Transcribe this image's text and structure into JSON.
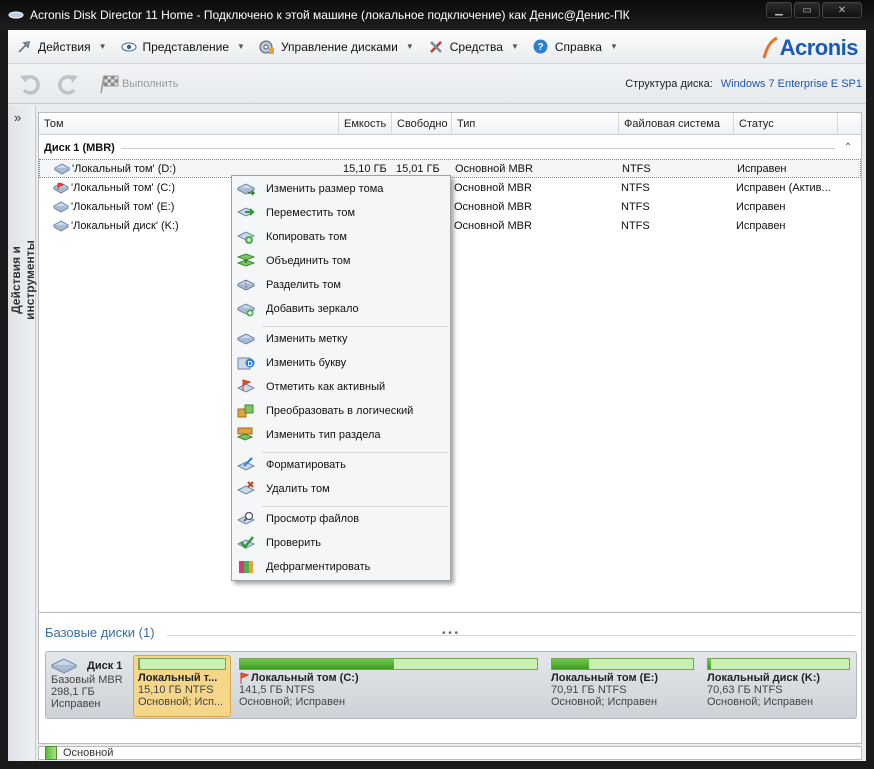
{
  "window": {
    "title": "Acronis Disk Director 11 Home - Подключено к этой машине (локальное подключение) как Денис@Денис-ПК",
    "buttons": [
      "▁",
      "▭",
      "✕"
    ]
  },
  "menubar": {
    "items": [
      {
        "label": "Действия",
        "icon": "actions-icon"
      },
      {
        "label": "Представление",
        "icon": "eye-icon"
      },
      {
        "label": "Управление дисками",
        "icon": "disk-manage-icon"
      },
      {
        "label": "Средства",
        "icon": "tools-icon"
      },
      {
        "label": "Справка",
        "icon": "help-icon"
      }
    ],
    "logo": "Acronis"
  },
  "toolbar": {
    "run_label": "Выполнить",
    "disk_structure_label": "Структура диска:",
    "disk_structure_value": "Windows 7 Enterprise E SP1"
  },
  "sidebar": {
    "label": "Действия и инструменты",
    "chevron": "»"
  },
  "table": {
    "columns": [
      "Том",
      "Емкость",
      "Свободно",
      "Тип",
      "Файловая система",
      "Статус"
    ],
    "group": "Диск 1 (MBR)",
    "rows": [
      {
        "name": "'Локальный том' (D:)",
        "capacity": "15,10 ГБ",
        "free": "15,01 ГБ",
        "type": "Основной MBR",
        "fs": "NTFS",
        "status": "Исправен",
        "selected": true
      },
      {
        "name": "'Локальный том' (C:)",
        "capacity": "",
        "free": "",
        "type": "Основной MBR",
        "fs": "NTFS",
        "status": "Исправен (Актив...",
        "selected": false
      },
      {
        "name": "'Локальный том' (E:)",
        "capacity": "",
        "free": "",
        "type": "Основной MBR",
        "fs": "NTFS",
        "status": "Исправен",
        "selected": false
      },
      {
        "name": "'Локальный диск' (K:)",
        "capacity": "",
        "free": "",
        "type": "Основной MBR",
        "fs": "NTFS",
        "status": "Исправен",
        "selected": false
      }
    ]
  },
  "context_menu": {
    "items": [
      {
        "label": "Изменить размер тома",
        "icon": "resize-volume-icon"
      },
      {
        "label": "Переместить том",
        "icon": "move-volume-icon"
      },
      {
        "label": "Копировать том",
        "icon": "copy-volume-icon"
      },
      {
        "label": "Объединить том",
        "icon": "merge-volume-icon"
      },
      {
        "label": "Разделить том",
        "icon": "split-volume-icon"
      },
      {
        "label": "Добавить зеркало",
        "icon": "add-mirror-icon"
      },
      {
        "label": "Изменить метку",
        "icon": "change-label-icon"
      },
      {
        "label": "Изменить букву",
        "icon": "change-letter-icon"
      },
      {
        "label": "Отметить как активный",
        "icon": "mark-active-icon"
      },
      {
        "label": "Преобразовать в логический",
        "icon": "convert-logical-icon"
      },
      {
        "label": "Изменить тип раздела",
        "icon": "partition-type-icon"
      },
      {
        "label": "Форматировать",
        "icon": "format-icon"
      },
      {
        "label": "Удалить том",
        "icon": "delete-volume-icon"
      },
      {
        "label": "Просмотр файлов",
        "icon": "browse-files-icon"
      },
      {
        "label": "Проверить",
        "icon": "check-icon"
      },
      {
        "label": "Дефрагментировать",
        "icon": "defrag-icon"
      }
    ]
  },
  "basic_disks": {
    "title": "Базовые диски (1)",
    "disk": {
      "name": "Диск 1",
      "type": "Базовый MBR",
      "size": "298,1 ГБ",
      "status": "Исправен"
    },
    "volumes": [
      {
        "name": "Локальный т...",
        "size": "15,10 ГБ NTFS",
        "status": "Основной; Исп...",
        "used_fraction": 0.01,
        "selected": true
      },
      {
        "name": "Локальный том (C:)",
        "size": "141,5 ГБ NTFS",
        "status": "Основной; Исправен",
        "used_fraction": 0.52,
        "selected": false
      },
      {
        "name": "Локальный том (E:)",
        "size": "70,91 ГБ NTFS",
        "status": "Основной; Исправен",
        "used_fraction": 0.26,
        "selected": false
      },
      {
        "name": "Локальный диск (K:)",
        "size": "70,63 ГБ NTFS",
        "status": "Основной; Исправен",
        "used_fraction": 0.02,
        "selected": false
      }
    ]
  },
  "legend": {
    "label": "Основной"
  },
  "colors": {
    "accent": "#1c56b5",
    "title_blue": "#3a6ea5",
    "selection": "#f6d78a",
    "bar_green": "#4fb42e"
  }
}
